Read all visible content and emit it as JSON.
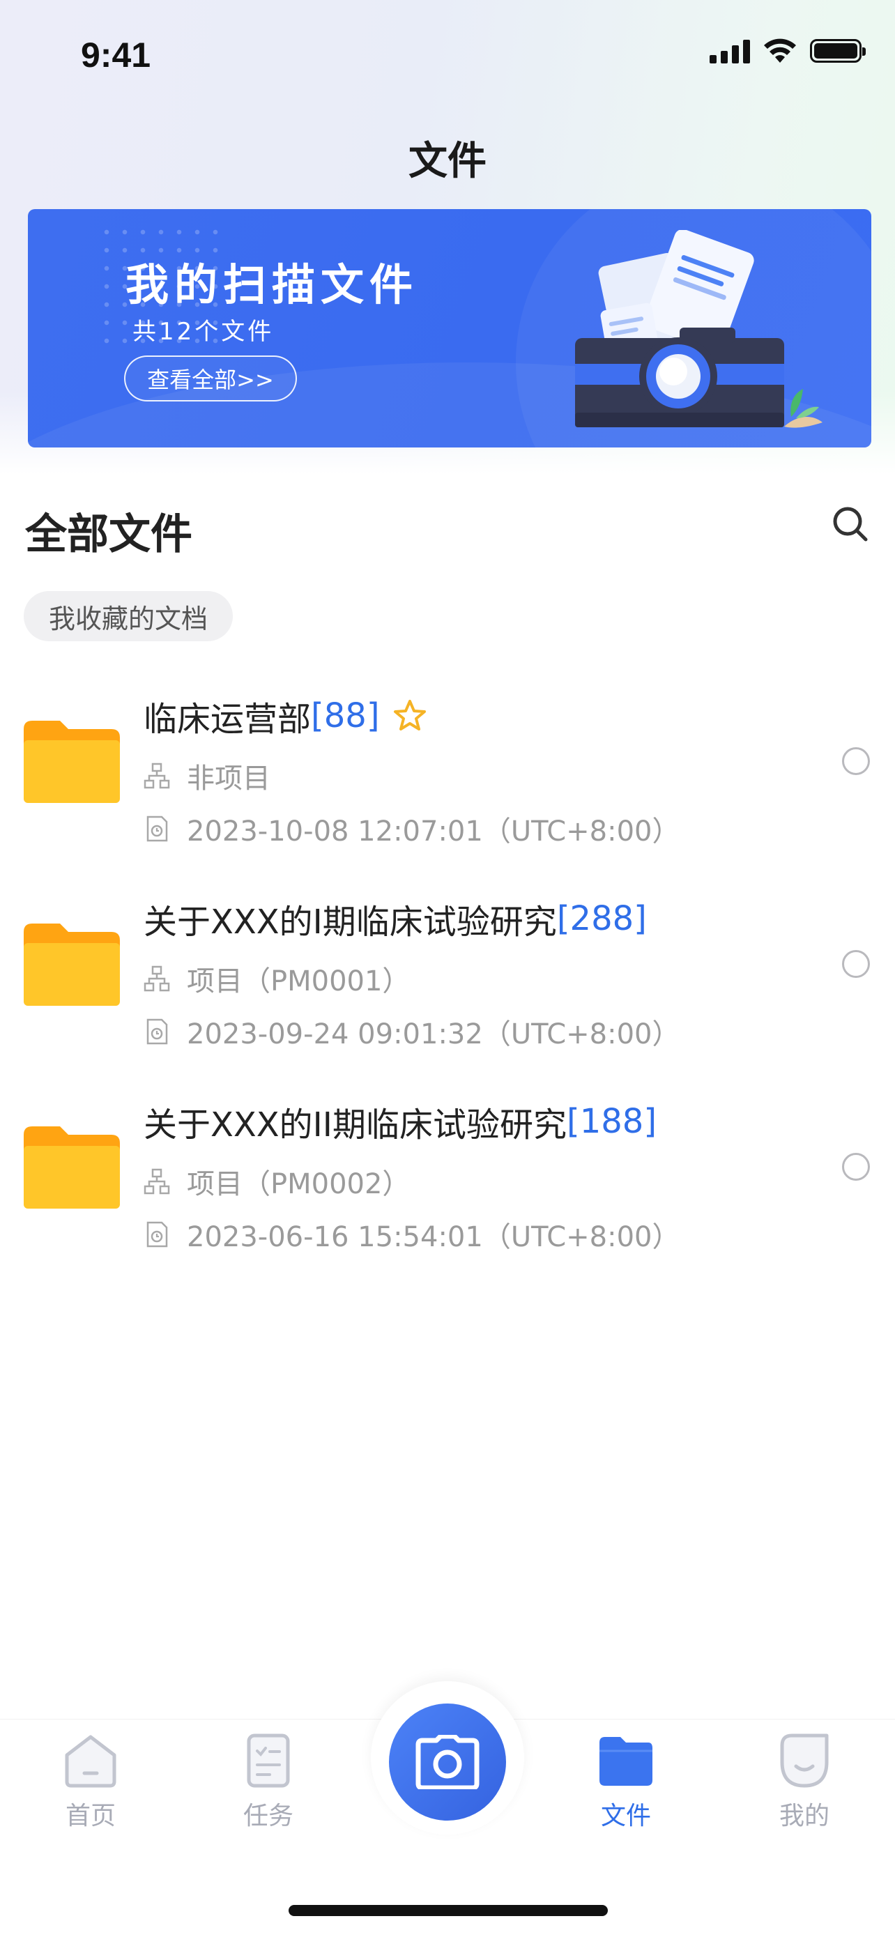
{
  "status_bar": {
    "time": "9:41"
  },
  "header": {
    "title": "文件"
  },
  "banner": {
    "title": "我的扫描文件",
    "subtitle": "共12个文件",
    "button_label": "查看全部>>"
  },
  "section": {
    "title": "全部文件",
    "filter_chip": "我收藏的文档"
  },
  "files": [
    {
      "name": "临床运营部",
      "count": "[88]",
      "favorite": true,
      "project": "非项目",
      "time": "2023-10-08 12:07:01（UTC+8:00）"
    },
    {
      "name": "关于XXX的I期临床试验研究",
      "count": "[288]",
      "favorite": false,
      "project": "项目（PM0001）",
      "time": "2023-09-24 09:01:32（UTC+8:00）"
    },
    {
      "name": "关于XXX的II期临床试验研究",
      "count": "[188]",
      "favorite": false,
      "project": "项目（PM0002）",
      "time": "2023-06-16 15:54:01（UTC+8:00）"
    }
  ],
  "tabbar": {
    "items": [
      {
        "label": "首页",
        "icon": "home-icon"
      },
      {
        "label": "任务",
        "icon": "task-icon"
      },
      {
        "label": "文件",
        "icon": "folder-icon",
        "active": true
      },
      {
        "label": "我的",
        "icon": "profile-icon"
      }
    ],
    "center_icon": "camera-icon"
  },
  "colors": {
    "accent": "#2f6ee8",
    "banner": "#3e6ef0",
    "folder": "#ffc629",
    "star": "#f5b325"
  }
}
